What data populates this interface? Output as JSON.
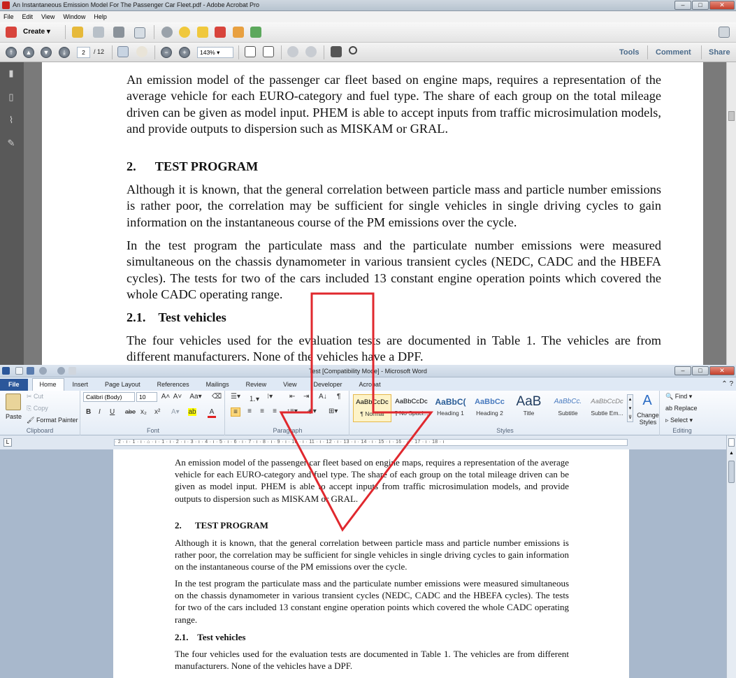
{
  "acrobat": {
    "title": "An Instantaneous Emission Model For The Passenger Car Fleet.pdf - Adobe Acrobat Pro",
    "menu": [
      "File",
      "Edit",
      "View",
      "Window",
      "Help"
    ],
    "create_label": "Create",
    "page_current": "2",
    "page_total": "/ 12",
    "zoom": "143%",
    "tools_label": "Tools",
    "comment_label": "Comment",
    "share_label": "Share",
    "doc": {
      "p1": "An emission model of the passenger car fleet based on engine maps, requires a representation of the average vehicle for each EURO-category and fuel type. The share of each group on the total mileage driven can be given as model input. PHEM is able to accept inputs from traffic microsimulation models, and provide outputs to dispersion such as MISKAM or GRAL.",
      "h2": "2.      TEST PROGRAM",
      "p2": "Although it is known, that the general correlation between particle mass and particle number emissions is rather poor, the correlation may be sufficient for single vehicles in single driving cycles to gain information on the instantaneous course of the PM emissions over the cycle.",
      "p3": "In the test program the particulate mass and the particulate number emissions were measured simultaneous on the chassis dynamometer in various transient cycles (NEDC, CADC and the HBEFA cycles). The tests for two of the cars included 13 constant engine operation points which covered the whole CADC operating range.",
      "h21": "2.1.    Test vehicles",
      "p4": "The four vehicles used for the evaluation tests are documented in Table 1. The vehicles are from different manufacturers. None of the vehicles have a DPF."
    }
  },
  "word": {
    "title": "Test [Compatibility Mode] - Microsoft Word",
    "tabs": [
      "File",
      "Home",
      "Insert",
      "Page Layout",
      "References",
      "Mailings",
      "Review",
      "View",
      "Developer",
      "Acrobat"
    ],
    "clipboard": {
      "paste": "Paste",
      "cut": "Cut",
      "copy": "Copy",
      "format_painter": "Format Painter",
      "label": "Clipboard"
    },
    "font": {
      "name": "Calibri (Body)",
      "size": "10",
      "label": "Font"
    },
    "paragraph_label": "Paragraph",
    "styles": {
      "label": "Styles",
      "items": [
        {
          "preview": "AaBbCcDc",
          "name": "¶ Normal"
        },
        {
          "preview": "AaBbCcDc",
          "name": "¶ No Spaci..."
        },
        {
          "preview": "AaBbC(",
          "name": "Heading 1"
        },
        {
          "preview": "AaBbCc",
          "name": "Heading 2"
        },
        {
          "preview": "AaB",
          "name": "Title"
        },
        {
          "preview": "AaBbCc.",
          "name": "Subtitle"
        },
        {
          "preview": "AaBbCcDc",
          "name": "Subtle Em..."
        }
      ],
      "change_styles": "Change Styles"
    },
    "editing": {
      "find": "Find",
      "replace": "Replace",
      "select": "Select",
      "label": "Editing"
    },
    "ruler": "· 2 · ı · 1 · ı · ⌂ · ı · 1 · ı · 2 · ı · 3 · ı · 4 · ı · 5 · ı · 6 · ı · 7 · ı · 8 · ı · 9 · ı · 10 · ı · 11 · ı · 12 · ı · 13 · ı · 14 · ı · 15 · ı · 16 · ⌂ · 17 · ı · 18 · ı",
    "doc": {
      "p1": "An emission model of the passenger car fleet based on engine maps, requires a representation of the average vehicle for each EURO-category and fuel type. The share of each group on the total mileage driven can be given as model input. PHEM is able to accept inputs from traffic microsimulation models, and provide outputs to dispersion such as MISKAM or GRAL.",
      "h2": "2.      TEST PROGRAM",
      "p2": "Although it is known, that the general correlation between particle mass and particle number emissions is rather poor, the correlation may be sufficient for single vehicles in single driving cycles to gain information on the instantaneous course of the PM emissions over the cycle.",
      "p3": "In the test program the particulate mass and the particulate number emissions were measured simultaneous on the chassis dynamometer in various transient cycles (NEDC, CADC and the HBEFA cycles). The tests for two of the cars included 13 constant engine operation points which covered the whole CADC operating range.",
      "h21": "2.1.    Test vehicles",
      "p4": "The four vehicles used for the evaluation tests are documented in Table 1. The vehicles are from different manufacturers. None of the vehicles have a DPF."
    }
  },
  "colors": {
    "arrow": "#e0282e",
    "word_file_tab": "#2b579a",
    "acrobat_sidebar": "#595959"
  }
}
